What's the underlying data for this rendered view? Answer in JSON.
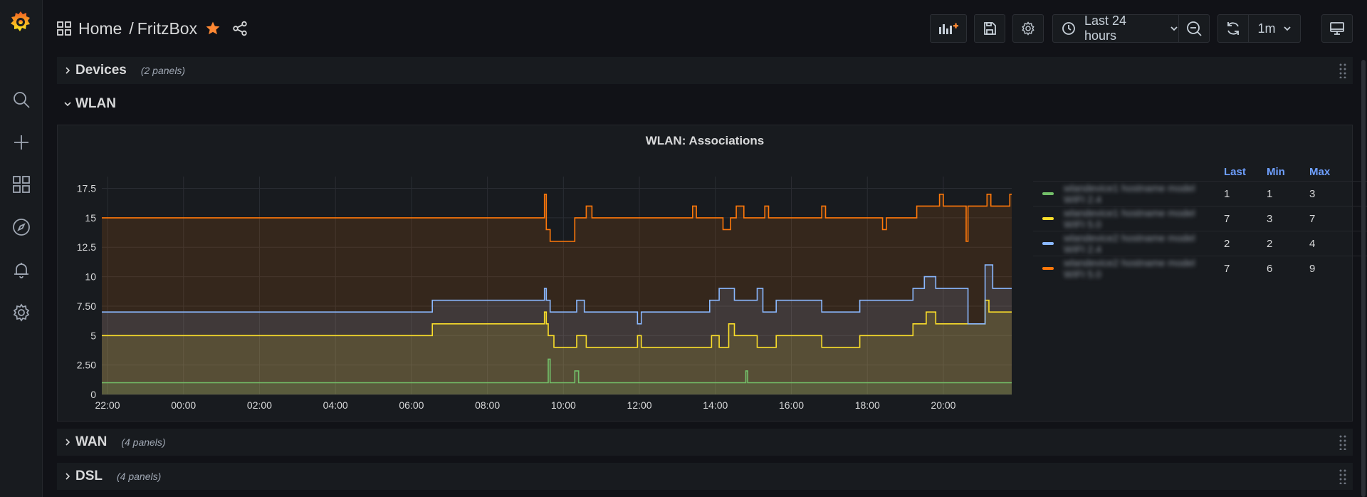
{
  "app": {
    "title": "FritzBox"
  },
  "breadcrumb": {
    "home": "Home",
    "separator": "/",
    "dashboard": "FritzBox"
  },
  "toolbar": {
    "time_range": "Last 24 hours",
    "refresh_interval": "1m"
  },
  "sidebar": {
    "items": [
      "search-icon",
      "plus-icon",
      "dashboards-icon",
      "explore-icon",
      "alerting-icon",
      "settings-icon"
    ]
  },
  "rows": {
    "devices": {
      "title": "Devices",
      "count": "(2 panels)"
    },
    "wlan": {
      "title": "WLAN"
    },
    "wan": {
      "title": "WAN",
      "count": "(4 panels)"
    },
    "dsl": {
      "title": "DSL",
      "count": "(4 panels)"
    }
  },
  "panel": {
    "title": "WLAN: Associations"
  },
  "legend": {
    "headers": {
      "last": "Last",
      "min": "Min",
      "max": "Max"
    },
    "items": [
      {
        "name": "wlandevice1 hostname model WIFI 2.4",
        "color": "#73bf69",
        "last": "1",
        "min": "1",
        "max": "3"
      },
      {
        "name": "wlandevice1 hostname model WIFI 5.0",
        "color": "#fade2a",
        "last": "7",
        "min": "3",
        "max": "7"
      },
      {
        "name": "wlandevice2 hostname model WIFI 2.4",
        "color": "#8ab8ff",
        "last": "2",
        "min": "2",
        "max": "4"
      },
      {
        "name": "wlandevice2 hostname model WIFI 5.0",
        "color": "#ff780a",
        "last": "7",
        "min": "6",
        "max": "9"
      }
    ]
  },
  "chart_data": {
    "type": "area",
    "title": "WLAN: Associations",
    "ylim": [
      0,
      18.5
    ],
    "y_ticks": [
      "0",
      "2.50",
      "5",
      "7.50",
      "10",
      "12.5",
      "15",
      "17.5"
    ],
    "y_tick_values": [
      0,
      2.5,
      5,
      7.5,
      10,
      12.5,
      15,
      17.5
    ],
    "x_ticks": [
      "22:00",
      "00:00",
      "02:00",
      "04:00",
      "06:00",
      "08:00",
      "10:00",
      "12:00",
      "14:00",
      "16:00",
      "18:00",
      "20:00"
    ],
    "x_tick_hours": [
      -2,
      0,
      2,
      4,
      6,
      8,
      10,
      12,
      14,
      16,
      18,
      20
    ],
    "xlim_hours": [
      -2.15,
      21.8
    ],
    "grid": true,
    "stacked": true,
    "series": [
      {
        "color": "#73bf69",
        "points": [
          [
            -2.15,
            1
          ],
          [
            9.6,
            1
          ],
          [
            9.6,
            3
          ],
          [
            9.65,
            3
          ],
          [
            9.65,
            1
          ],
          [
            10.3,
            1
          ],
          [
            10.3,
            2
          ],
          [
            10.4,
            2
          ],
          [
            10.4,
            1
          ],
          [
            14.8,
            1
          ],
          [
            14.8,
            2
          ],
          [
            14.85,
            2
          ],
          [
            14.85,
            1
          ],
          [
            21.8,
            1
          ]
        ]
      },
      {
        "color": "#fade2a",
        "points": [
          [
            -2.15,
            5
          ],
          [
            6.55,
            5
          ],
          [
            6.55,
            6
          ],
          [
            9.5,
            6
          ],
          [
            9.5,
            7
          ],
          [
            9.55,
            7
          ],
          [
            9.55,
            6
          ],
          [
            9.6,
            6
          ],
          [
            9.6,
            5
          ],
          [
            9.75,
            5
          ],
          [
            9.75,
            4
          ],
          [
            10.35,
            4
          ],
          [
            10.35,
            5
          ],
          [
            10.6,
            5
          ],
          [
            10.6,
            4
          ],
          [
            11.95,
            4
          ],
          [
            11.95,
            5
          ],
          [
            12.05,
            5
          ],
          [
            12.05,
            4
          ],
          [
            13.9,
            4
          ],
          [
            13.9,
            5
          ],
          [
            14.1,
            5
          ],
          [
            14.1,
            4
          ],
          [
            14.35,
            4
          ],
          [
            14.35,
            6
          ],
          [
            14.5,
            6
          ],
          [
            14.5,
            5
          ],
          [
            15.1,
            5
          ],
          [
            15.1,
            4
          ],
          [
            15.6,
            4
          ],
          [
            15.6,
            5
          ],
          [
            16.8,
            5
          ],
          [
            16.8,
            4
          ],
          [
            17.8,
            4
          ],
          [
            17.8,
            5
          ],
          [
            19.2,
            5
          ],
          [
            19.2,
            6
          ],
          [
            19.55,
            6
          ],
          [
            19.55,
            7
          ],
          [
            19.8,
            7
          ],
          [
            19.8,
            6
          ],
          [
            21.1,
            6
          ],
          [
            21.1,
            8
          ],
          [
            21.2,
            8
          ],
          [
            21.2,
            7
          ],
          [
            21.8,
            7
          ]
        ]
      },
      {
        "color": "#8ab8ff",
        "points": [
          [
            -2.15,
            7
          ],
          [
            6.55,
            7
          ],
          [
            6.55,
            8
          ],
          [
            9.5,
            8
          ],
          [
            9.5,
            9
          ],
          [
            9.55,
            9
          ],
          [
            9.55,
            8
          ],
          [
            9.65,
            8
          ],
          [
            9.65,
            7
          ],
          [
            10.35,
            7
          ],
          [
            10.35,
            8
          ],
          [
            10.55,
            8
          ],
          [
            10.55,
            7
          ],
          [
            11.95,
            7
          ],
          [
            11.95,
            6
          ],
          [
            12.05,
            6
          ],
          [
            12.05,
            7
          ],
          [
            13.85,
            7
          ],
          [
            13.85,
            8
          ],
          [
            14.1,
            8
          ],
          [
            14.1,
            9
          ],
          [
            14.5,
            9
          ],
          [
            14.5,
            8
          ],
          [
            15.1,
            8
          ],
          [
            15.1,
            9
          ],
          [
            15.25,
            9
          ],
          [
            15.25,
            7
          ],
          [
            15.6,
            7
          ],
          [
            15.6,
            8
          ],
          [
            16.8,
            8
          ],
          [
            16.8,
            7
          ],
          [
            17.8,
            7
          ],
          [
            17.8,
            8
          ],
          [
            19.2,
            8
          ],
          [
            19.2,
            9
          ],
          [
            19.5,
            9
          ],
          [
            19.5,
            10
          ],
          [
            19.8,
            10
          ],
          [
            19.8,
            9
          ],
          [
            20.65,
            9
          ],
          [
            20.65,
            6
          ],
          [
            21.1,
            6
          ],
          [
            21.1,
            11
          ],
          [
            21.3,
            11
          ],
          [
            21.3,
            9
          ],
          [
            21.8,
            9
          ]
        ]
      },
      {
        "color": "#ff780a",
        "points": [
          [
            -2.15,
            15
          ],
          [
            9.5,
            15
          ],
          [
            9.5,
            17
          ],
          [
            9.55,
            17
          ],
          [
            9.55,
            14
          ],
          [
            9.65,
            14
          ],
          [
            9.65,
            13
          ],
          [
            10.3,
            13
          ],
          [
            10.3,
            15
          ],
          [
            10.6,
            15
          ],
          [
            10.6,
            16
          ],
          [
            10.75,
            16
          ],
          [
            10.75,
            15
          ],
          [
            13.4,
            15
          ],
          [
            13.4,
            16
          ],
          [
            13.5,
            16
          ],
          [
            13.5,
            15
          ],
          [
            14.2,
            15
          ],
          [
            14.2,
            14
          ],
          [
            14.4,
            14
          ],
          [
            14.4,
            15
          ],
          [
            14.55,
            15
          ],
          [
            14.55,
            16
          ],
          [
            14.75,
            16
          ],
          [
            14.75,
            15
          ],
          [
            15.3,
            15
          ],
          [
            15.3,
            16
          ],
          [
            15.4,
            16
          ],
          [
            15.4,
            15
          ],
          [
            16.8,
            15
          ],
          [
            16.8,
            16
          ],
          [
            16.9,
            16
          ],
          [
            16.9,
            15
          ],
          [
            18.4,
            15
          ],
          [
            18.4,
            14
          ],
          [
            18.5,
            14
          ],
          [
            18.5,
            15
          ],
          [
            19.3,
            15
          ],
          [
            19.3,
            16
          ],
          [
            19.9,
            16
          ],
          [
            19.9,
            17
          ],
          [
            20.0,
            17
          ],
          [
            20.0,
            16
          ],
          [
            20.6,
            16
          ],
          [
            20.6,
            13
          ],
          [
            20.65,
            13
          ],
          [
            20.65,
            16
          ],
          [
            21.15,
            16
          ],
          [
            21.15,
            17
          ],
          [
            21.25,
            17
          ],
          [
            21.25,
            16
          ],
          [
            21.75,
            16
          ],
          [
            21.75,
            17
          ],
          [
            21.8,
            17
          ]
        ]
      }
    ]
  }
}
